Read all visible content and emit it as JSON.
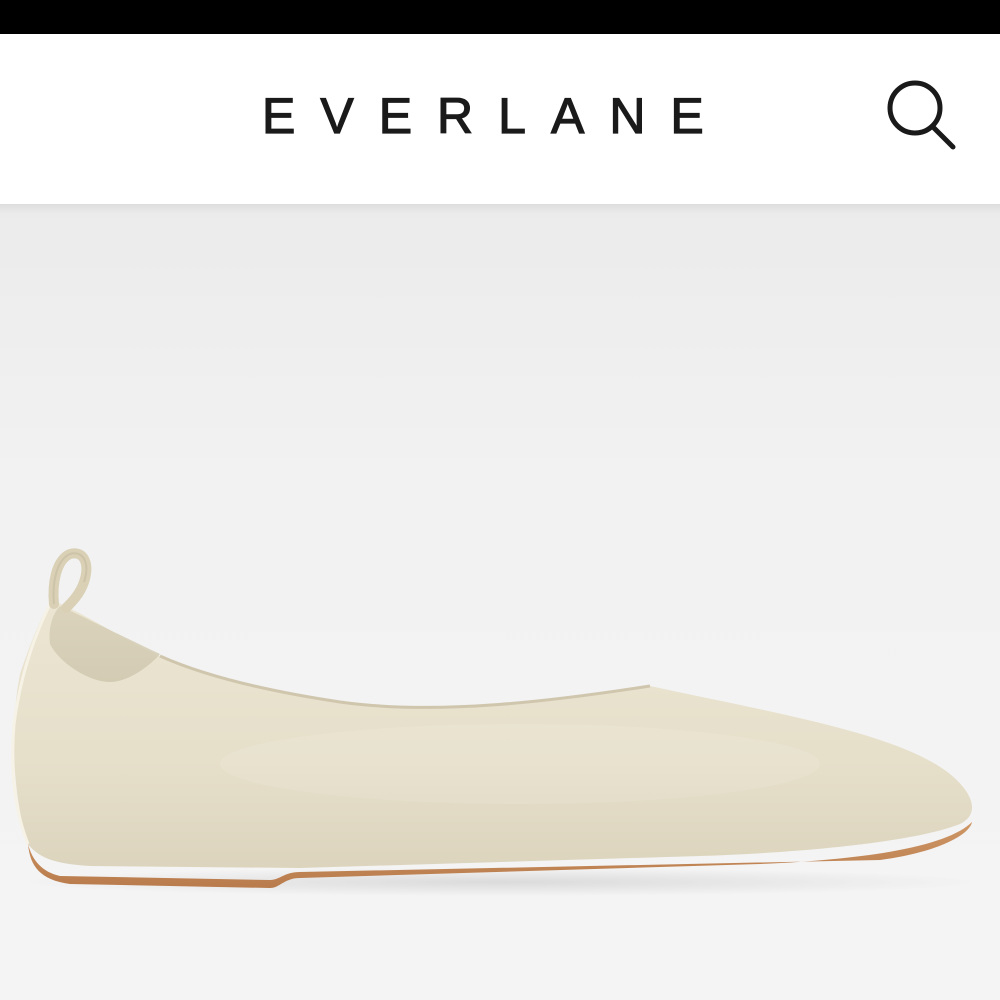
{
  "header": {
    "brand": "EVERLANE"
  },
  "icons": {
    "search": "search-icon"
  },
  "colors": {
    "status_bar": "#000000",
    "header_bg": "#ffffff",
    "brand_text": "#1a1a1a",
    "hero_bg": "#f2f2f2",
    "shoe_upper": "#e8e2cf",
    "shoe_sole": "#c58b5c"
  }
}
